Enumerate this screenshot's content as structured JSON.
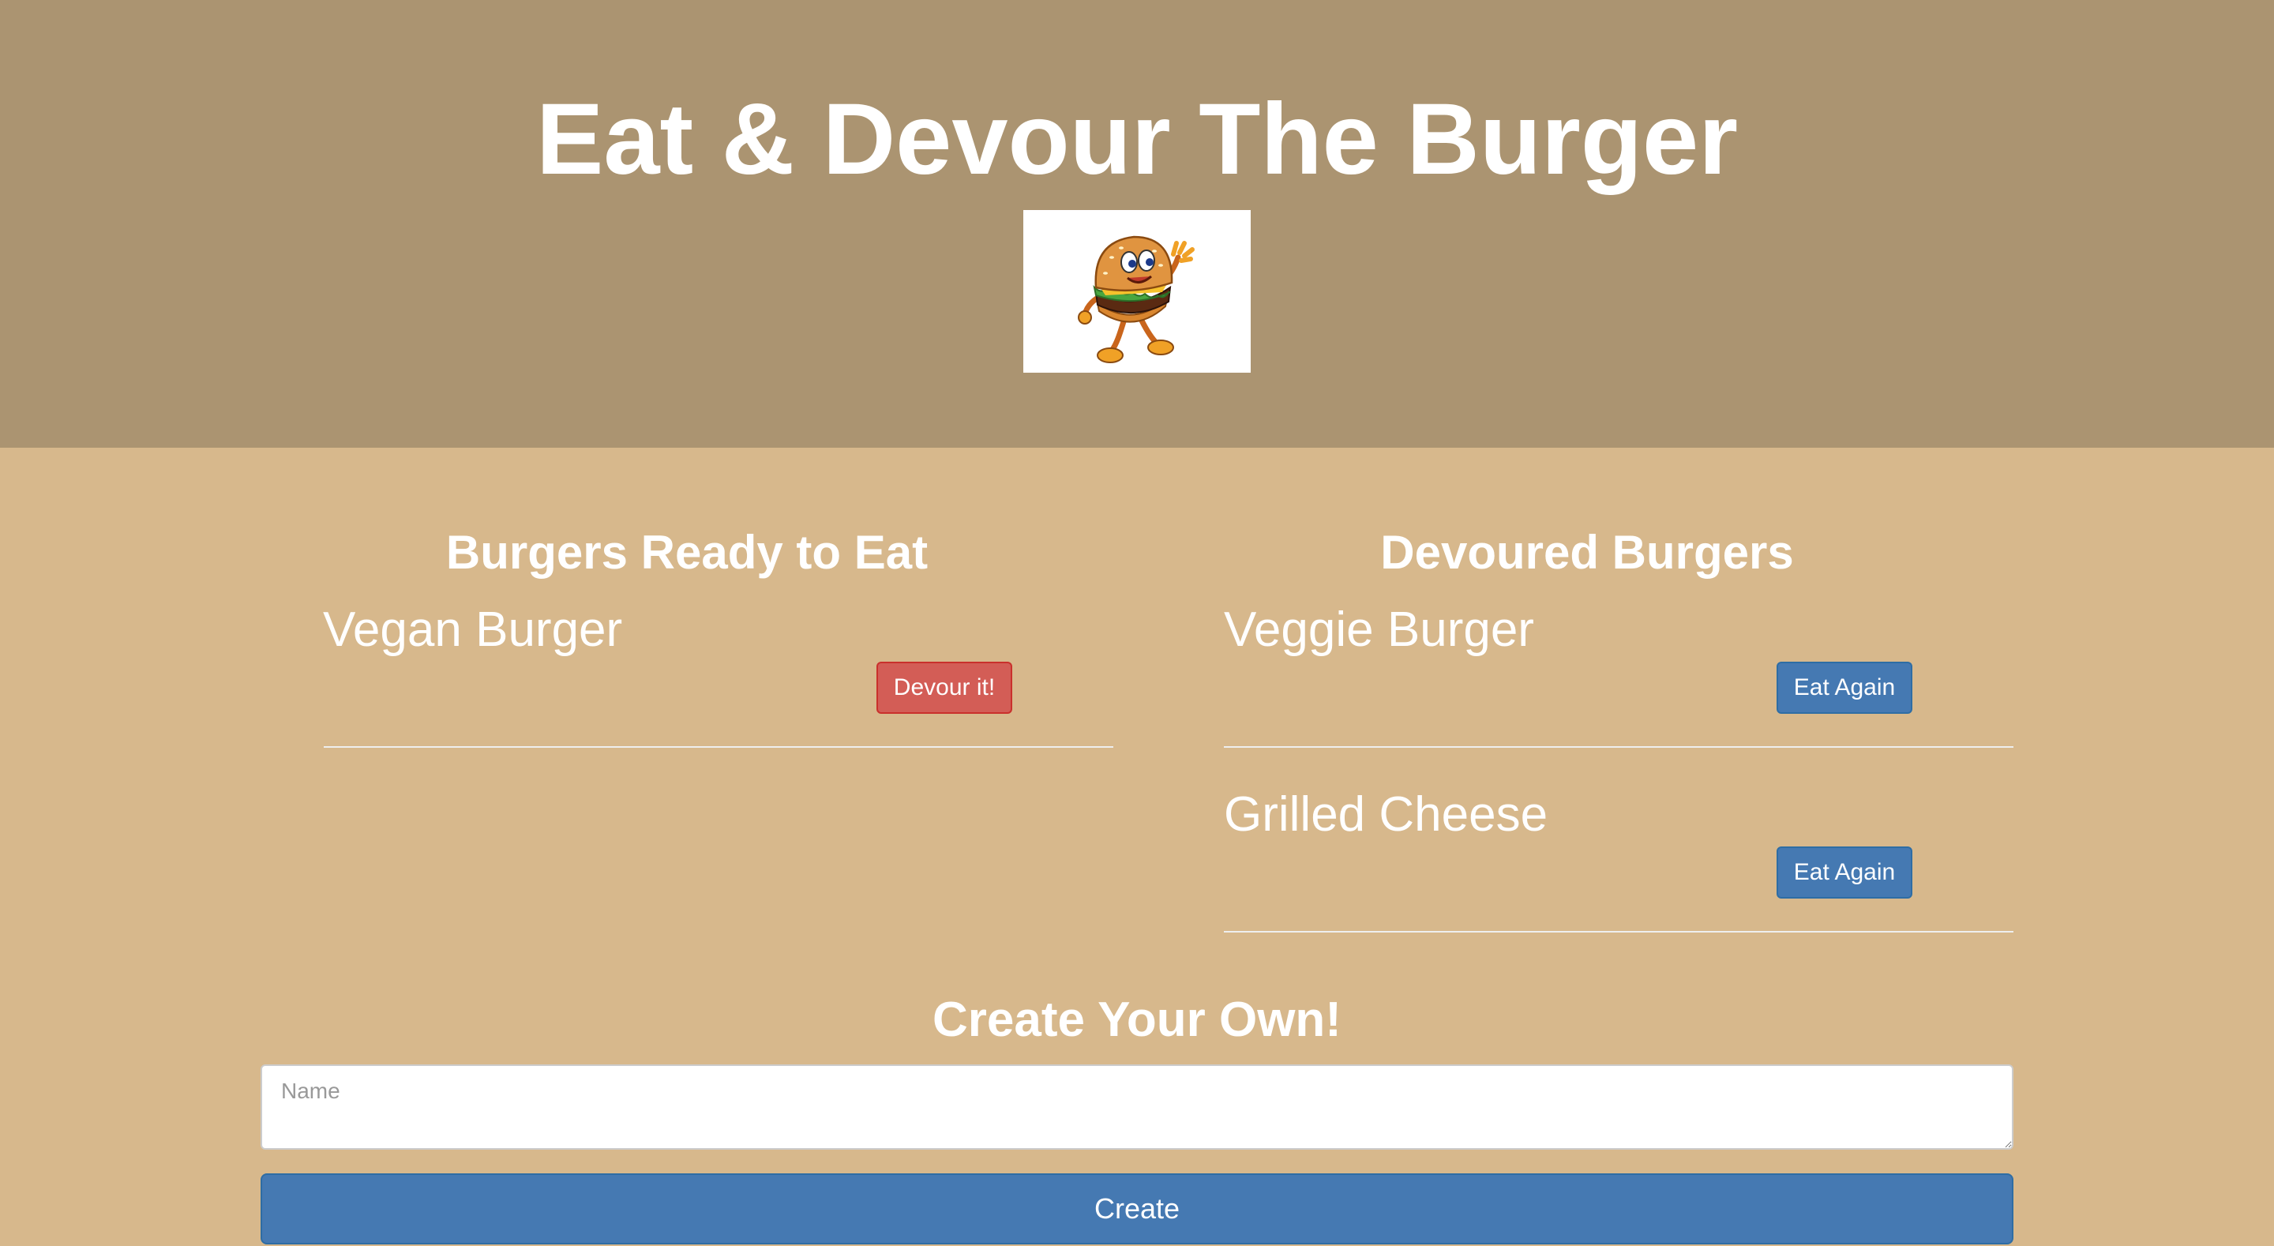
{
  "header": {
    "title": "Eat & Devour The Burger",
    "logo_icon": "waving-burger-mascot-icon"
  },
  "ready": {
    "heading": "Burgers Ready to Eat",
    "items": [
      {
        "name": "Vegan Burger",
        "button_label": "Devour it!"
      }
    ]
  },
  "devoured": {
    "heading": "Devoured Burgers",
    "items": [
      {
        "name": "Veggie Burger",
        "button_label": "Eat Again"
      },
      {
        "name": "Grilled Cheese",
        "button_label": "Eat Again"
      }
    ]
  },
  "create": {
    "heading": "Create Your Own!",
    "placeholder": "Name",
    "button_label": "Create"
  },
  "colors": {
    "header_bg": "#ab9471",
    "page_bg": "#d7b88c",
    "danger": "#d35d56",
    "primary": "#4579b2"
  }
}
